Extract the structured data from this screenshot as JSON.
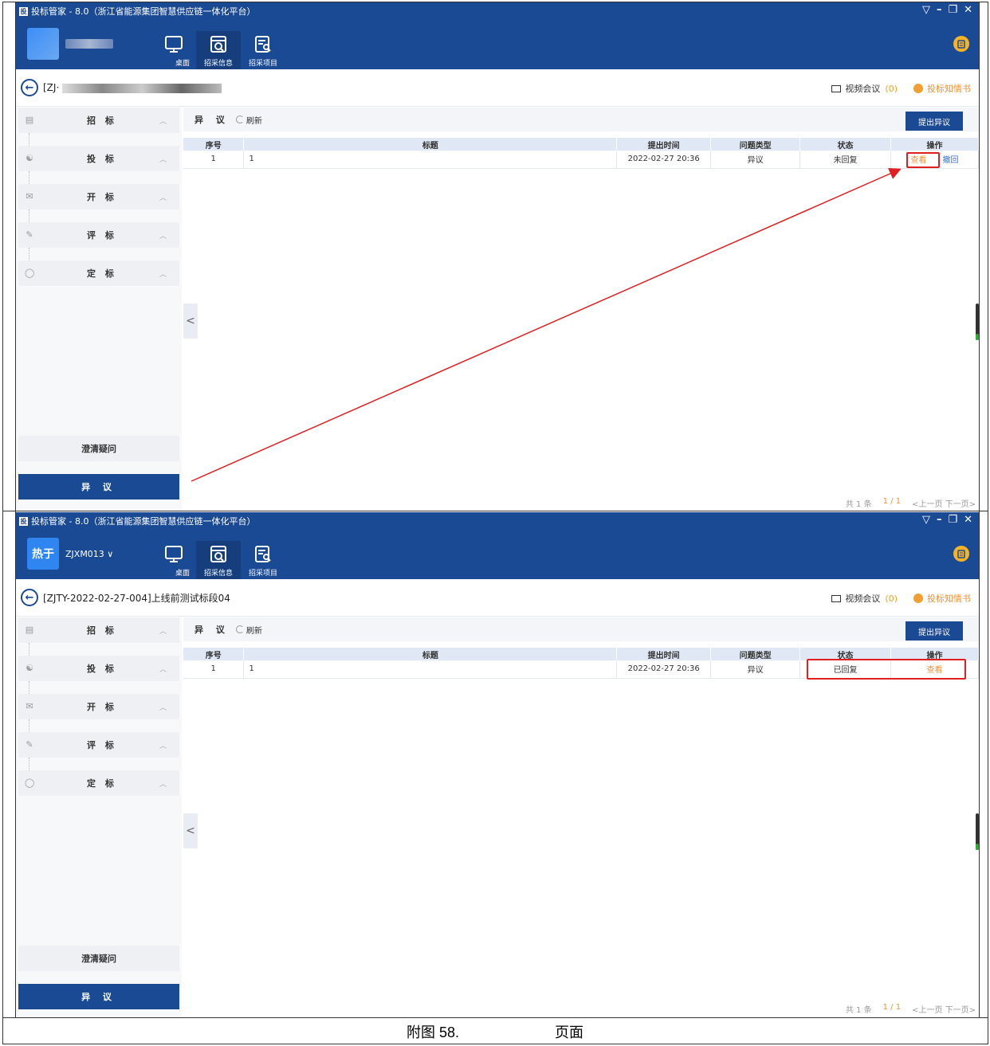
{
  "app": {
    "window_title": "投标管家 - 8.0（浙江省能源集团智慧供应链一体化平台）",
    "logo_glyph": "投",
    "win_controls": [
      "▽",
      "–",
      "❐",
      "✕"
    ]
  },
  "nav": {
    "tabs": [
      {
        "label": "桌面",
        "icon": "desktop-icon"
      },
      {
        "label": "招采信息",
        "icon": "search-doc-icon",
        "active": true
      },
      {
        "label": "招采项目",
        "icon": "project-list-icon"
      }
    ]
  },
  "top_panel": {
    "user_avatar_text": "",
    "user_name": "",
    "project_title_prefix": "[ZJ·"
  },
  "bottom_panel": {
    "user_avatar_text": "热于",
    "user_name": "ZJXM013 ∨",
    "project_title": "[ZJTY-2022-02-27-004]上线前测试标段04"
  },
  "header_right": {
    "video_meeting_label": "视频会议",
    "video_meeting_count": "(0)",
    "notice_label": "投标知情书"
  },
  "sidebar": {
    "items": [
      {
        "label": "招 标",
        "icon": "doc-icon"
      },
      {
        "label": "投 标",
        "icon": "bid-icon"
      },
      {
        "label": "开 标",
        "icon": "envelope-icon"
      },
      {
        "label": "评 标",
        "icon": "edit-icon"
      },
      {
        "label": "定 标",
        "icon": "check-circle-icon"
      }
    ],
    "chevron": "︿",
    "clarify_label": "澄清疑问",
    "objection_label": "异 议"
  },
  "main": {
    "section_title": "异 议",
    "refresh_label": "刷新",
    "submit_label": "提出异议",
    "collapse_glyph": "<",
    "columns": [
      "序号",
      "标题",
      "提出时间",
      "问题类型",
      "状态",
      "操作"
    ]
  },
  "rows_top": [
    {
      "no": "1",
      "title": "1",
      "time": "2022-02-27 20:36",
      "type": "异议",
      "status": "未回复",
      "op_view": "查看",
      "op_withdraw": "撤回"
    }
  ],
  "rows_bottom": [
    {
      "no": "1",
      "title": "1",
      "time": "2022-02-27 20:36",
      "type": "异议",
      "status": "已回复",
      "op_view": "查看"
    }
  ],
  "pager": {
    "total": "共 1 条",
    "page": "1 / 1",
    "nav": "<上一页 下一页>"
  },
  "caption": {
    "left": "附图 58.",
    "right": "页面"
  },
  "colors": {
    "header_blue": "#1b4a95",
    "accent_orange": "#f09030",
    "highlight_red": "#e02020"
  }
}
